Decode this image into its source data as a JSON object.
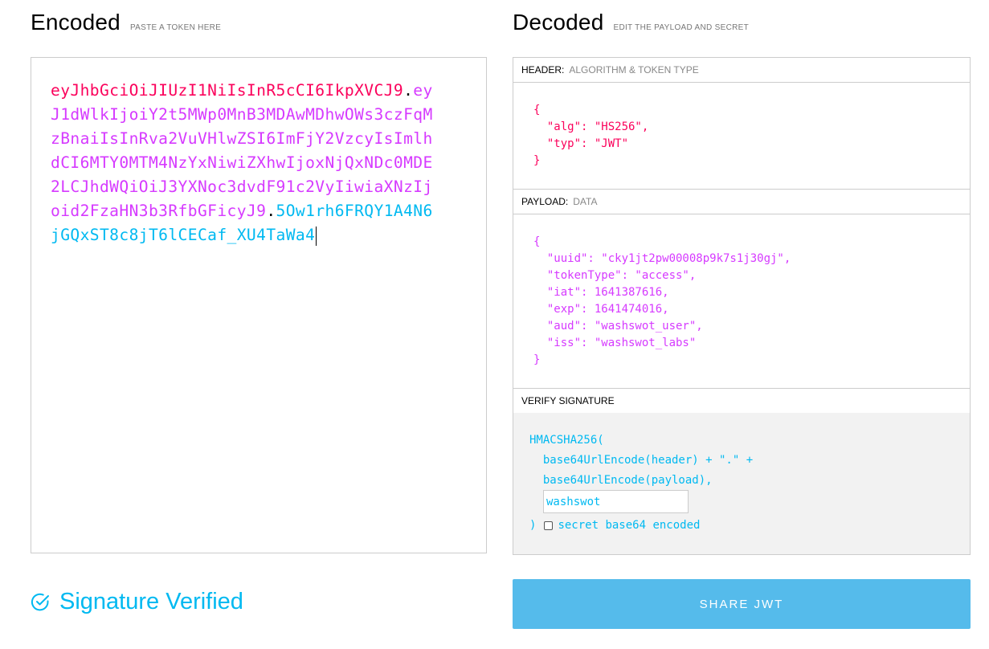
{
  "encoded": {
    "title": "Encoded",
    "subtitle": "PASTE A TOKEN HERE",
    "token": {
      "header": "eyJhbGciOiJIUzI1NiIsInR5cCI6IkpXVCJ9",
      "dot1": ".",
      "payload": "eyJ1dWlkIjoiY2t5MWp0MnB3MDAwMDhwOWs3czFqMzBnaiIsInRva2VuVHlwZSI6ImFjY2VzcyIsImlhdCI6MTY0MTM4NzYxNiwiZXhwIjoxNjQxNDc0MDE2LCJhdWQiOiJ3YXNoc3dvdF91c2VyIiwiaXNzIjoid2FzaHN3b3RfbGFicyJ9",
      "dot2": ".",
      "signature": "5Ow1rh6FRQY1A4N6jGQxST8c8jT6lCECaf_XU4TaWa4"
    }
  },
  "decoded": {
    "title": "Decoded",
    "subtitle": "EDIT THE PAYLOAD AND SECRET",
    "header_section": {
      "label": "HEADER:",
      "sublabel": "ALGORITHM & TOKEN TYPE"
    },
    "header_json": "{\n  \"alg\": \"HS256\",\n  \"typ\": \"JWT\"\n}",
    "payload_section": {
      "label": "PAYLOAD:",
      "sublabel": "DATA"
    },
    "payload_json": "{\n  \"uuid\": \"cky1jt2pw00008p9k7s1j30gj\",\n  \"tokenType\": \"access\",\n  \"iat\": 1641387616,\n  \"exp\": 1641474016,\n  \"aud\": \"washswot_user\",\n  \"iss\": \"washswot_labs\"\n}",
    "signature_section": {
      "label": "VERIFY SIGNATURE"
    },
    "signature_code": "HMACSHA256(\n  base64UrlEncode(header) + \".\" +\n  base64UrlEncode(payload),",
    "secret_value": "washswot",
    "signature_close": ")",
    "base64_label": "secret base64 encoded"
  },
  "status": {
    "text": "Signature Verified",
    "color": "#00b9f1"
  },
  "share_button": {
    "label": "SHARE JWT"
  },
  "colors": {
    "header": "#fb015b",
    "payload": "#d63aff",
    "signature": "#00b9f1",
    "button": "#55bbeb"
  }
}
